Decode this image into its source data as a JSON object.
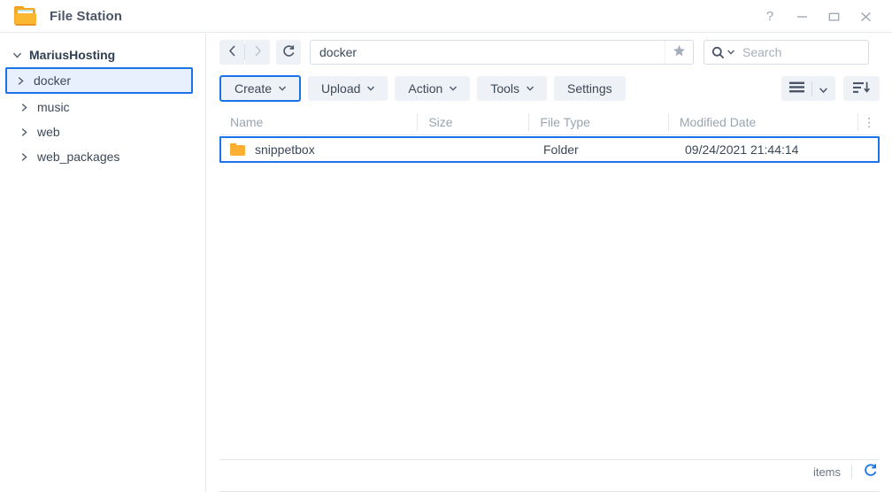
{
  "window": {
    "title": "File Station",
    "icon": "folder-icon",
    "controls": [
      {
        "name": "help-button",
        "glyph": "?"
      },
      {
        "name": "minimize-button",
        "glyph": "minimize-icon"
      },
      {
        "name": "maximize-button",
        "glyph": "maximize-icon"
      },
      {
        "name": "close-button",
        "glyph": "close-icon"
      }
    ]
  },
  "sidebar": {
    "root": {
      "label": "MariusHosting",
      "expanded": true
    },
    "items": [
      {
        "label": "docker",
        "selected": true
      },
      {
        "label": "music",
        "selected": false
      },
      {
        "label": "web",
        "selected": false
      },
      {
        "label": "web_packages",
        "selected": false
      }
    ]
  },
  "navbar": {
    "back_label": "‹",
    "forward_label": "›",
    "refresh_label": "refresh-icon",
    "path_value": "docker",
    "path_placeholder": "",
    "favorite_label": "★",
    "search_value": "",
    "search_placeholder": "Search"
  },
  "toolbar": {
    "buttons": [
      {
        "label": "Create",
        "caret": true,
        "focused": true
      },
      {
        "label": "Upload",
        "caret": true,
        "focused": false
      },
      {
        "label": "Action",
        "caret": true,
        "focused": false
      },
      {
        "label": "Tools",
        "caret": true,
        "focused": false
      },
      {
        "label": "Settings",
        "caret": false,
        "focused": false
      }
    ],
    "view_mode_label": "list-view-icon",
    "sort_label": "sort-descending-icon"
  },
  "filelist": {
    "columns": [
      {
        "label": "Name"
      },
      {
        "label": "Size"
      },
      {
        "label": "File Type"
      },
      {
        "label": "Modified Date"
      }
    ],
    "more_label": "⋮",
    "rows": [
      {
        "name": "snippetbox",
        "size": "",
        "type": "Folder",
        "date": "09/24/2021 21:44:14",
        "icon": "folder-icon",
        "selected": true
      }
    ]
  },
  "statusbar": {
    "items_label": "items",
    "refresh_label": "refresh-icon"
  },
  "colors": {
    "accent": "#1a73e8",
    "folder": "#fbb034",
    "toolbar_button": "#eef1f6",
    "border": "#e3e8ee",
    "text": "#3c4858",
    "muted": "#9aa5b1"
  }
}
